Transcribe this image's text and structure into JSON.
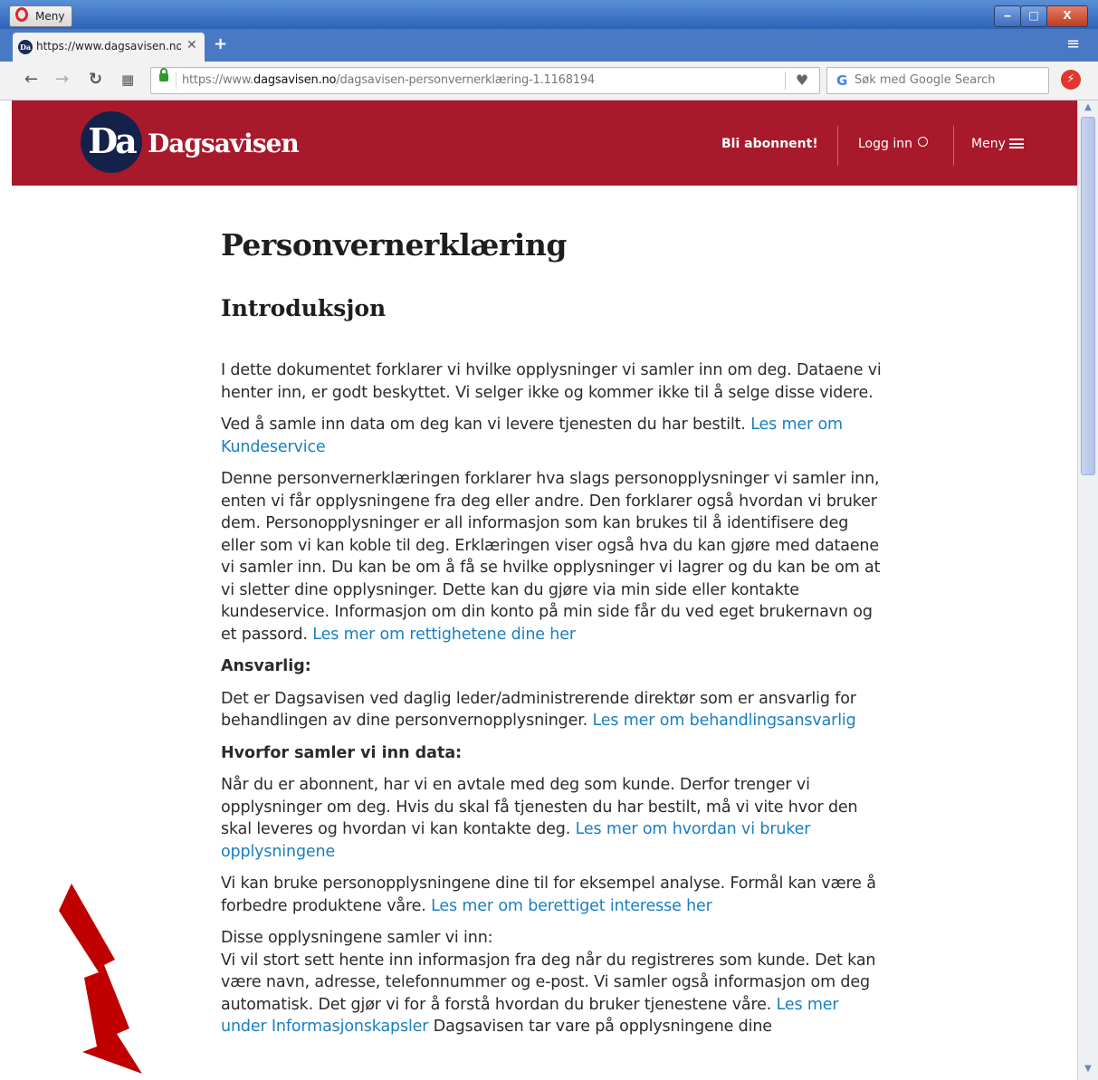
{
  "browser": {
    "menu_label": "Meny",
    "tab": {
      "title": "https://www.dagsavisen.no/"
    },
    "url": {
      "prefix": "https://www.",
      "domain": "dagsavisen.no",
      "path": "/dagsavisen-personvernerklæring-1.1168194"
    },
    "search_placeholder": "Søk med Google Search",
    "window_controls": {
      "minimize": "‒",
      "maximize": "□",
      "close": "X"
    }
  },
  "site": {
    "logo_mark": "Da",
    "logo_word": "Dagsavisen",
    "nav": {
      "subscribe": "Bli abonnent!",
      "login": "Logg inn",
      "menu": "Meny"
    },
    "brand_color": "#a8192c",
    "link_color": "#1a7fbf"
  },
  "article": {
    "title": "Personvernerklæring",
    "intro_heading": "Introduksjon",
    "p1": "I dette dokumentet forklarer vi hvilke opplysninger vi samler inn om deg. Dataene vi henter inn, er godt beskyttet. Vi selger ikke og kommer ikke til å selge disse videre.",
    "p2_text": "Ved å samle inn data om deg kan vi levere tjenesten du har bestilt. ",
    "p2_link": "Les mer om Kundeservice",
    "p3_text": "Denne personvernerklæringen forklarer hva slags personopplysninger vi samler inn, enten vi får opplysningene fra deg eller andre. Den forklarer også hvordan vi bruker dem. Personopplysninger er all informasjon som kan brukes til å identifisere deg eller som vi kan koble til deg. Erklæringen viser også hva du kan gjøre med dataene vi samler inn. Du kan be om å få se hvilke opplysninger vi lagrer og du kan be om at vi sletter dine opplysninger. Dette kan du gjøre via min side eller kontakte kundeservice. Informasjon om din konto på min side får du ved eget brukernavn og et passord. ",
    "p3_link": "Les mer om rettighetene dine her",
    "responsible_heading": "Ansvarlig:",
    "p4_text": "Det er Dagsavisen ved daglig leder/administrerende direktør som er ansvarlig for behandlingen av dine personvernopplysninger. ",
    "p4_link": "Les mer om behandlingsansvarlig",
    "why_heading": "Hvorfor samler vi inn data:",
    "p5_text": "Når du er abonnent, har vi en avtale med deg som kunde. Derfor trenger vi opplysninger om deg. Hvis du skal få tjenesten du har bestilt, må vi vite hvor den skal leveres og hvordan vi kan kontakte deg. ",
    "p5_link": "Les mer om hvordan vi bruker opplysningene",
    "p6_text": "Vi kan bruke personopplysningene dine til for eksempel analyse. Formål kan være å forbedre produktene våre. ",
    "p6_link": "Les mer om berettiget interesse her",
    "p7_line1": "Disse opplysningene samler vi inn:",
    "p7_text": "Vi vil stort sett hente inn informasjon fra deg når du registreres som kunde. Det kan være navn, adresse, telefonnummer og e-post. Vi samler også informasjon om deg automatisk. Det gjør vi for å forstå hvordan du bruker tjenestene våre. ",
    "p7_link": "Les mer under Informasjonskapsler",
    "p7_tail": " Dagsavisen tar vare på opplysningene dine"
  },
  "annotation": {
    "arrow_color": "#c00000"
  }
}
